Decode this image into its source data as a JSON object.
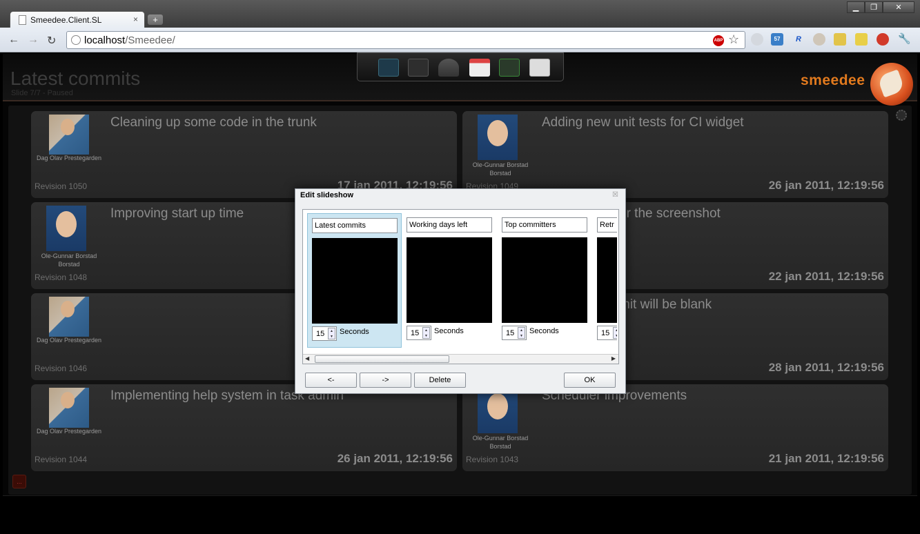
{
  "browser": {
    "tab_title": "Smeedee.Client.SL",
    "tab_close": "×",
    "newtab": "+",
    "url_host": "localhost",
    "url_path": "/Smeedee/",
    "window_buttons": [
      "▁",
      "❐",
      "✕"
    ],
    "abp_label": "ABP",
    "extension_badge": "57"
  },
  "app": {
    "title": "Latest commits",
    "subtitle": "Slide 7/7 - Paused",
    "logo": "smeedee",
    "more_label": "..."
  },
  "commits": [
    {
      "message": "Cleaning up some code in the trunk",
      "author": [
        "Dag Olav Prestegarden"
      ],
      "avatar": "dag",
      "revision": "Revision 1050",
      "date": "17 jan 2011, 12:19:56"
    },
    {
      "message": "Adding new unit tests for CI widget",
      "author": [
        "Ole-Gunnar Borstad",
        "Borstad"
      ],
      "avatar": "ole",
      "revision": "Revision 1049",
      "date": "26 jan 2011, 12:19:56"
    },
    {
      "message": "Improving start up time",
      "author": [
        "Ole-Gunnar Borstad",
        "Borstad"
      ],
      "avatar": "ole",
      "revision": "Revision 1048",
      "date": ""
    },
    {
      "message": "or the screenshot",
      "author": [],
      "avatar": "",
      "revision": "",
      "date": "22 jan 2011, 12:19:56"
    },
    {
      "message": "",
      "author": [
        "Dag Olav Prestegarden"
      ],
      "avatar": "dag",
      "revision": "Revision 1046",
      "date": ""
    },
    {
      "message": "mit will be blank",
      "author": [],
      "avatar": "",
      "revision": "",
      "date": "28 jan 2011, 12:19:56"
    },
    {
      "message": "Implementing help system in task admin",
      "author": [
        "Dag Olav Prestegarden"
      ],
      "avatar": "dag",
      "revision": "Revision 1044",
      "date": "26 jan 2011, 12:19:56"
    },
    {
      "message": "Scheduler improvements",
      "author": [
        "Ole-Gunnar Borstad",
        "Borstad"
      ],
      "avatar": "ole",
      "revision": "Revision 1043",
      "date": "21 jan 2011, 12:19:56"
    }
  ],
  "dialog": {
    "title": "Edit slideshow",
    "close": "☒",
    "slides": [
      {
        "name": "Latest commits",
        "seconds": "15",
        "selected": true
      },
      {
        "name": "Working days left",
        "seconds": "15",
        "selected": false
      },
      {
        "name": "Top committers",
        "seconds": "15",
        "selected": false
      },
      {
        "name": "Retr",
        "seconds": "15",
        "selected": false
      }
    ],
    "seconds_label": "Seconds",
    "buttons": {
      "prev": "<-",
      "next": "->",
      "delete": "Delete",
      "ok": "OK"
    }
  }
}
